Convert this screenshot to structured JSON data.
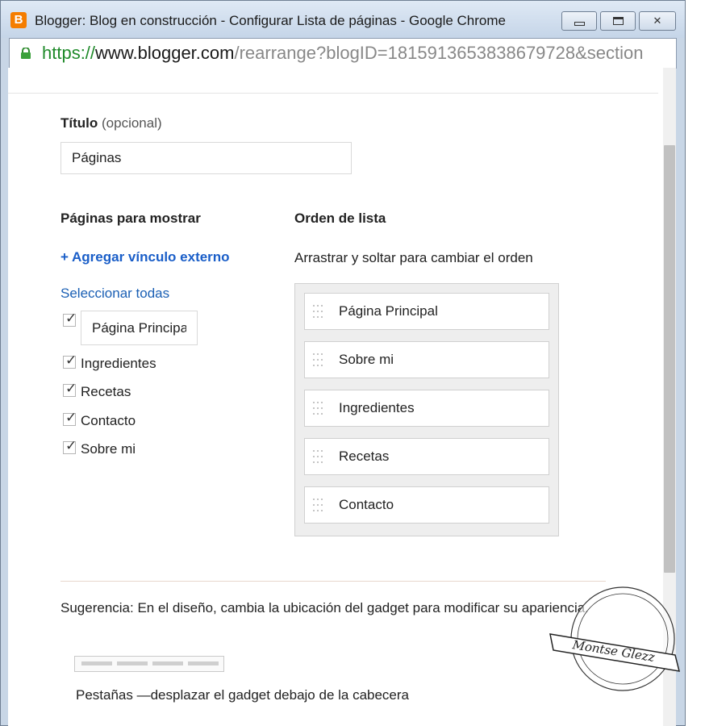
{
  "window": {
    "title": "Blogger: Blog en construcción - Configurar Lista de páginas - Google Chrome",
    "app_icon_letter": "B"
  },
  "address": {
    "scheme": "https://",
    "host": "www.blogger.com",
    "path": "/rearrange?blogID=1815913653838679728&section"
  },
  "form": {
    "title_label": "Título",
    "title_optional": "(opcional)",
    "title_value": "Páginas",
    "pages_heading": "Páginas para mostrar",
    "add_external_link": "+ Agregar vínculo externo",
    "select_all": "Seleccionar todas",
    "first_page_value": "Página Principa",
    "pages": [
      {
        "label": "Ingredientes",
        "checked": true
      },
      {
        "label": "Recetas",
        "checked": true
      },
      {
        "label": "Contacto",
        "checked": true
      },
      {
        "label": "Sobre mi",
        "checked": true
      }
    ],
    "order_heading": "Orden de lista",
    "order_hint": "Arrastrar y soltar para cambiar el orden",
    "order_items": [
      "Página Principal",
      "Sobre mi",
      "Ingredientes",
      "Recetas",
      "Contacto"
    ]
  },
  "tip": {
    "text": "Sugerencia: En el diseño, cambia la ubicación del gadget para modificar su apariencia.",
    "tabs_caption": "Pestañas —desplazar el gadget debajo de la cabecera"
  },
  "watermark": {
    "text": "Montse Glezz"
  },
  "colors": {
    "link": "#1a5fb4",
    "blogger_orange": "#f57d00",
    "https_green": "#1f8a2a"
  }
}
